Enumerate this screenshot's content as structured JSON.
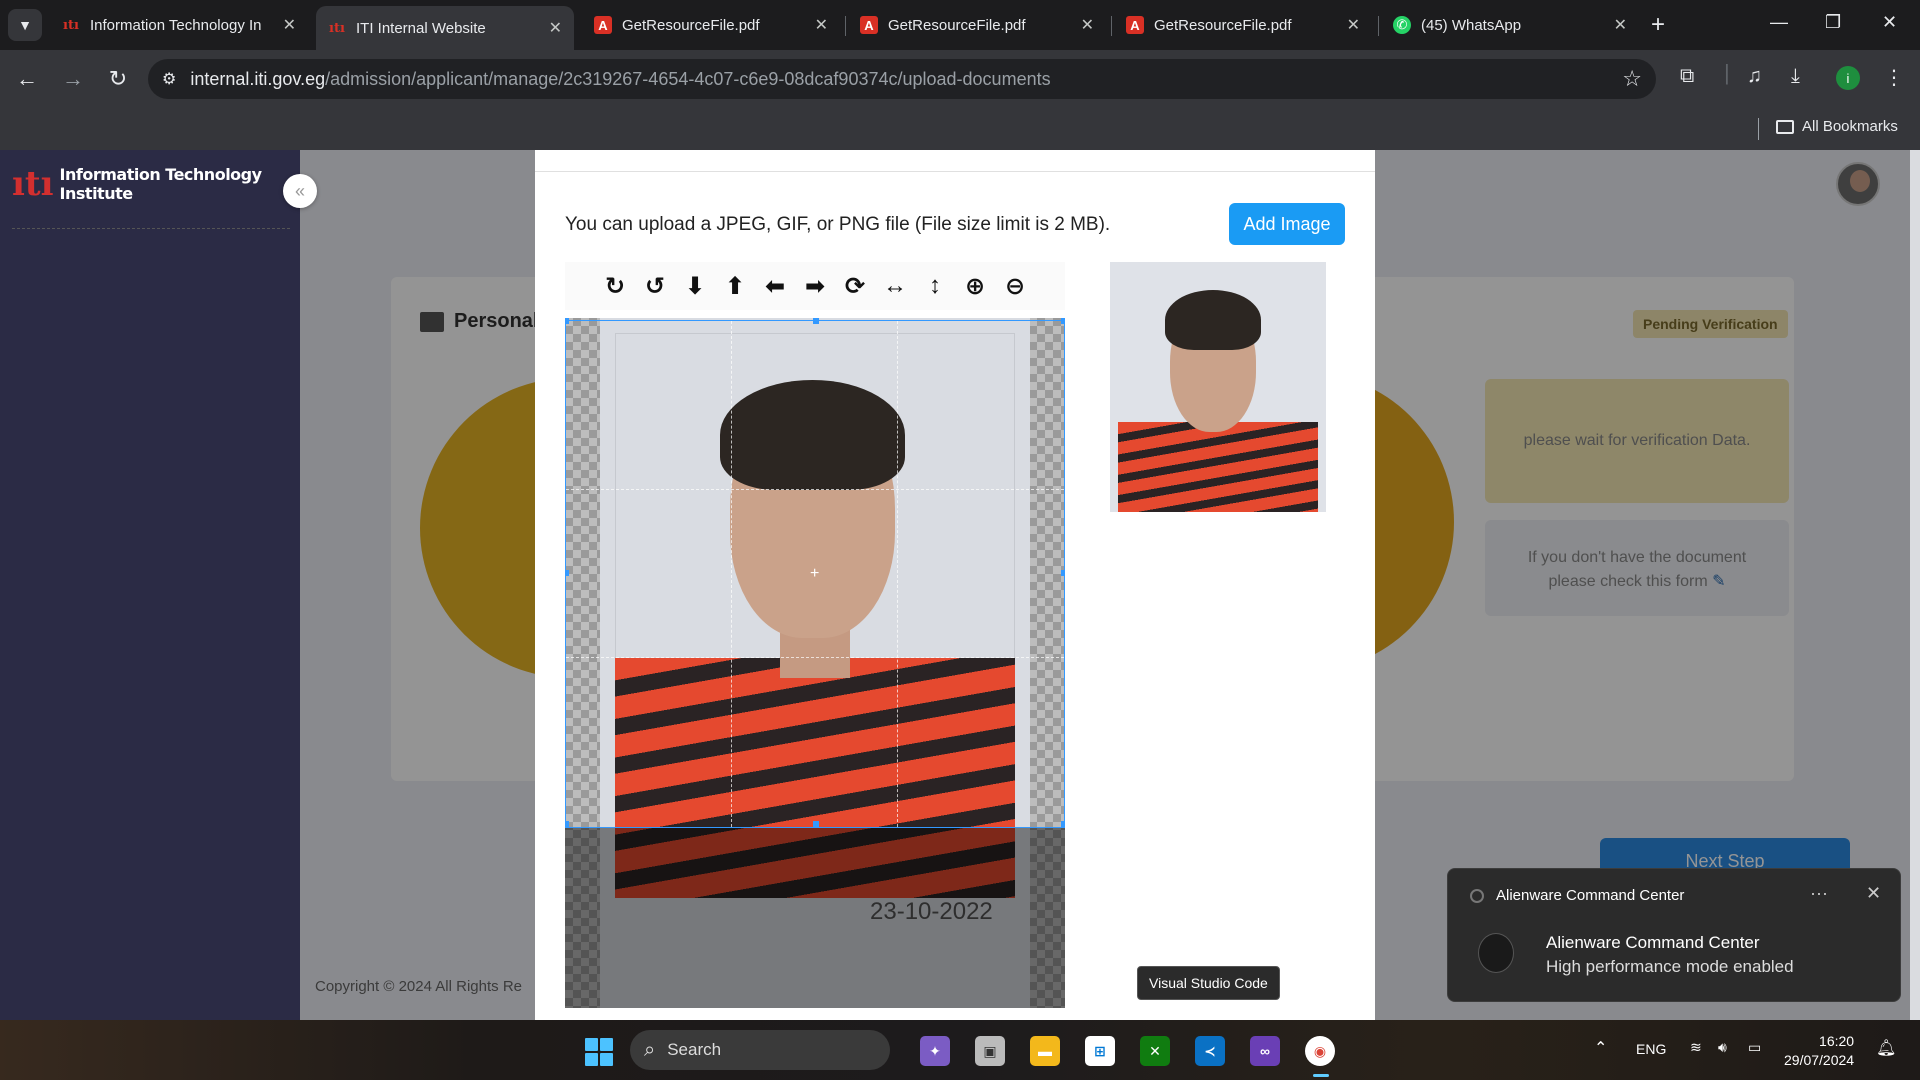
{
  "browser": {
    "tabs": [
      {
        "title": "Information Technology In",
        "icon": "iti-icon"
      },
      {
        "title": "ITI Internal Website",
        "icon": "iti-icon",
        "active": true
      },
      {
        "title": "GetResourceFile.pdf",
        "icon": "pdf-icon"
      },
      {
        "title": "GetResourceFile.pdf",
        "icon": "pdf-icon"
      },
      {
        "title": "GetResourceFile.pdf",
        "icon": "pdf-icon"
      },
      {
        "title": "(45) WhatsApp",
        "icon": "whatsapp-icon"
      }
    ],
    "url_host": "internal.iti.gov.eg",
    "url_path": "/admission/applicant/manage/2c319267-4654-4c07-c6e9-08dcaf90374c/upload-documents",
    "profile_initial": "i",
    "bookmarks_label": "All Bookmarks"
  },
  "site": {
    "logo_text": "Information Technology Institute",
    "section_title": "Personal",
    "status_badge": "Pending Verification",
    "verify_message": "please wait for verification Data.",
    "doc_message_line1": "If you don't have the document",
    "doc_message_line2": "please check this form",
    "next_button": "Next Step",
    "copyright": "Copyright © 2024 All Rights Re"
  },
  "modal": {
    "hint": "You can upload a JPEG, GIF, or PNG file (File size limit is 2 MB).",
    "add_image_label": "Add Image",
    "tools": [
      "rotate-right-icon",
      "rotate-left-icon",
      "move-down-icon",
      "move-up-icon",
      "move-left-icon",
      "move-right-icon",
      "reset-icon",
      "flip-horizontal-icon",
      "flip-vertical-icon",
      "zoom-in-icon",
      "zoom-out-icon"
    ],
    "photo_stamp": "23-10-2022"
  },
  "tooltip": "Visual Studio Code",
  "notification": {
    "app": "Alienware Command Center",
    "title": "Alienware Command Center",
    "body": "High performance mode enabled"
  },
  "taskbar": {
    "search_label": "Search",
    "language": "ENG",
    "time": "16:20",
    "date": "29/07/2024"
  }
}
